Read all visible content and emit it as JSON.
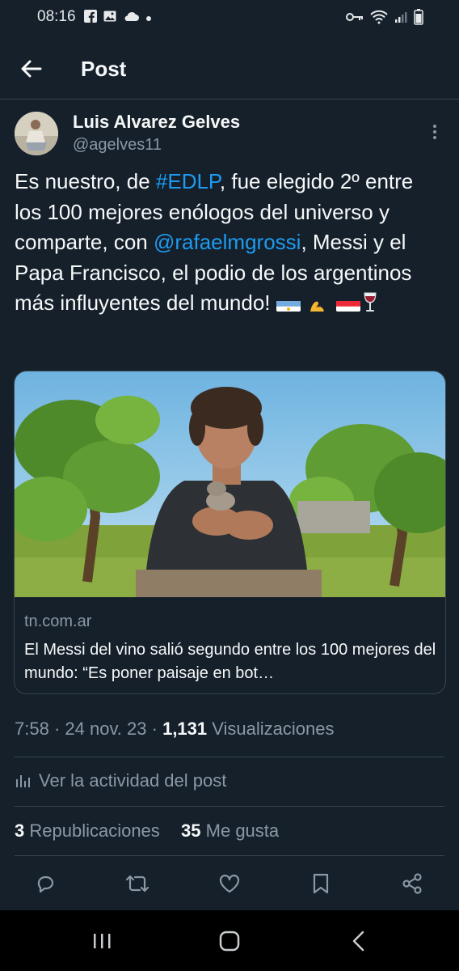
{
  "status_bar": {
    "time": "08:16",
    "left_icons": [
      "facebook-icon",
      "gallery-icon",
      "cloud-icon",
      "dot-icon"
    ],
    "right_icons": [
      "key-icon",
      "wifi-icon",
      "signal-icon",
      "battery-icon"
    ]
  },
  "header": {
    "title": "Post",
    "back_icon": "back-arrow-icon"
  },
  "post": {
    "author_name": "Luis Alvarez Gelves",
    "author_handle": "@agelves11",
    "text": {
      "part1": "Es nuestro, de ",
      "hashtag": "#EDLP",
      "part2": ", fue elegido 2º entre los 100 mejores enólogos del universo y comparte, con ",
      "mention": "@rafaelmgrossi",
      "part3": ", Messi y el Papa Francisco, el podio de los argentinos más influyentes del mundo! ",
      "emojis": [
        "flag-argentina",
        "flexed-biceps",
        "flag-austria",
        "wine-glass"
      ]
    },
    "card": {
      "domain": "tn.com.ar",
      "title": "El Messi del vino salió segundo entre los 100 mejores del mundo: “Es poner paisaje en bot…"
    },
    "meta": {
      "time": "7:58",
      "sep1": " · ",
      "date": "24 nov. 23",
      "sep2": " · ",
      "views": "1,131",
      "views_label": " Visualizaciones"
    },
    "activity_label": "Ver la actividad del post",
    "stats": {
      "reposts": "3",
      "reposts_label": " Republicaciones",
      "likes": "35",
      "likes_label": " Me gusta"
    },
    "actions": [
      "reply-icon",
      "repost-icon",
      "like-icon",
      "bookmark-icon",
      "share-icon"
    ]
  },
  "nav_bar": [
    "recent-apps-icon",
    "home-icon",
    "back-icon"
  ],
  "colors": {
    "background": "#15202b",
    "link": "#1d9bf0",
    "muted": "#8b98a5",
    "border": "#38444d"
  }
}
